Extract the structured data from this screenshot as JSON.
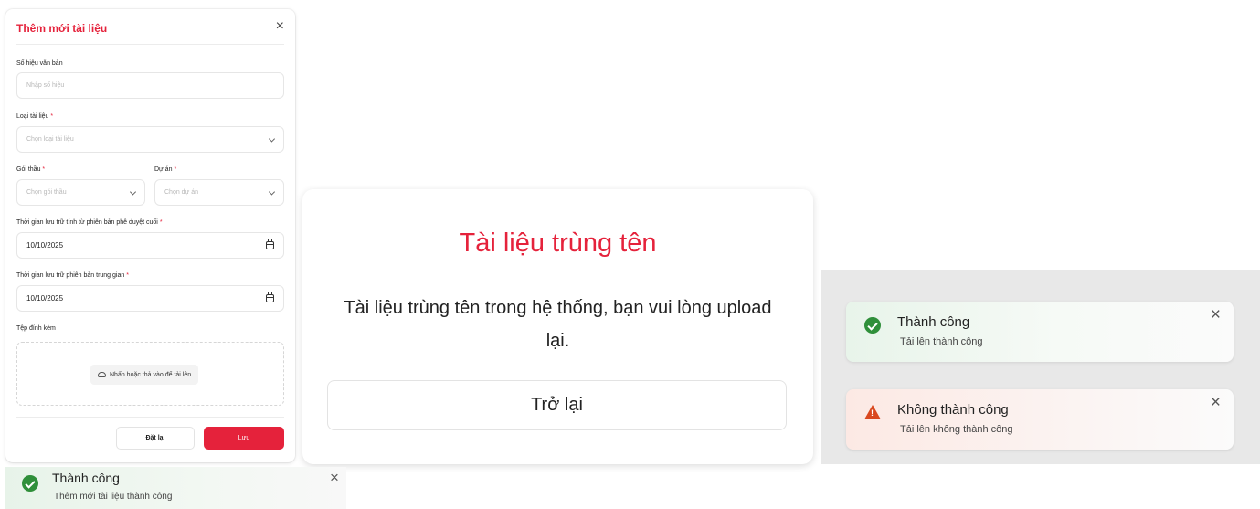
{
  "form": {
    "title": "Thêm mới tài liệu",
    "close": "×",
    "doc_number_label": "Số hiệu văn bản",
    "doc_number_placeholder": "Nhập số hiệu",
    "doc_type_label": "Loại tài liệu",
    "doc_type_placeholder": "Chọn loại tài liệu",
    "package_label": "Gói thầu",
    "package_placeholder": "Chọn gói thầu",
    "project_label": "Dự án",
    "project_placeholder": "Chọn dự án",
    "retention_final_label": "Thời gian lưu trữ tính từ phiên bản phê duyệt cuối",
    "retention_final_value": "10/10/2025",
    "retention_interim_label": "Thời gian lưu trữ phiên bản trung gian",
    "retention_interim_value": "10/10/2025",
    "attachment_label": "Tệp đính kèm",
    "upload_label": "Nhấn hoặc thả vào để tải lên",
    "required_mark": "*",
    "reset_label": "Đặt lại",
    "save_label": "Lưu"
  },
  "dialog": {
    "title": "Tài liệu trùng tên",
    "message": "Tài liệu trùng tên trong hệ thống, bạn vui lòng upload lại.",
    "back_label": "Trở lại"
  },
  "toasts": {
    "success": {
      "title": "Thành công",
      "message": "Tải lên thành công",
      "close": "×"
    },
    "error": {
      "title": "Không thành công",
      "message": "Tải lên không thành công",
      "close": "×"
    },
    "bottom_success": {
      "title": "Thành công",
      "message": "Thêm mới tài liệu thành công",
      "close": "×"
    }
  },
  "colors": {
    "brand": "#e5223b",
    "success": "#2f8f3a",
    "error": "#d9481f"
  }
}
